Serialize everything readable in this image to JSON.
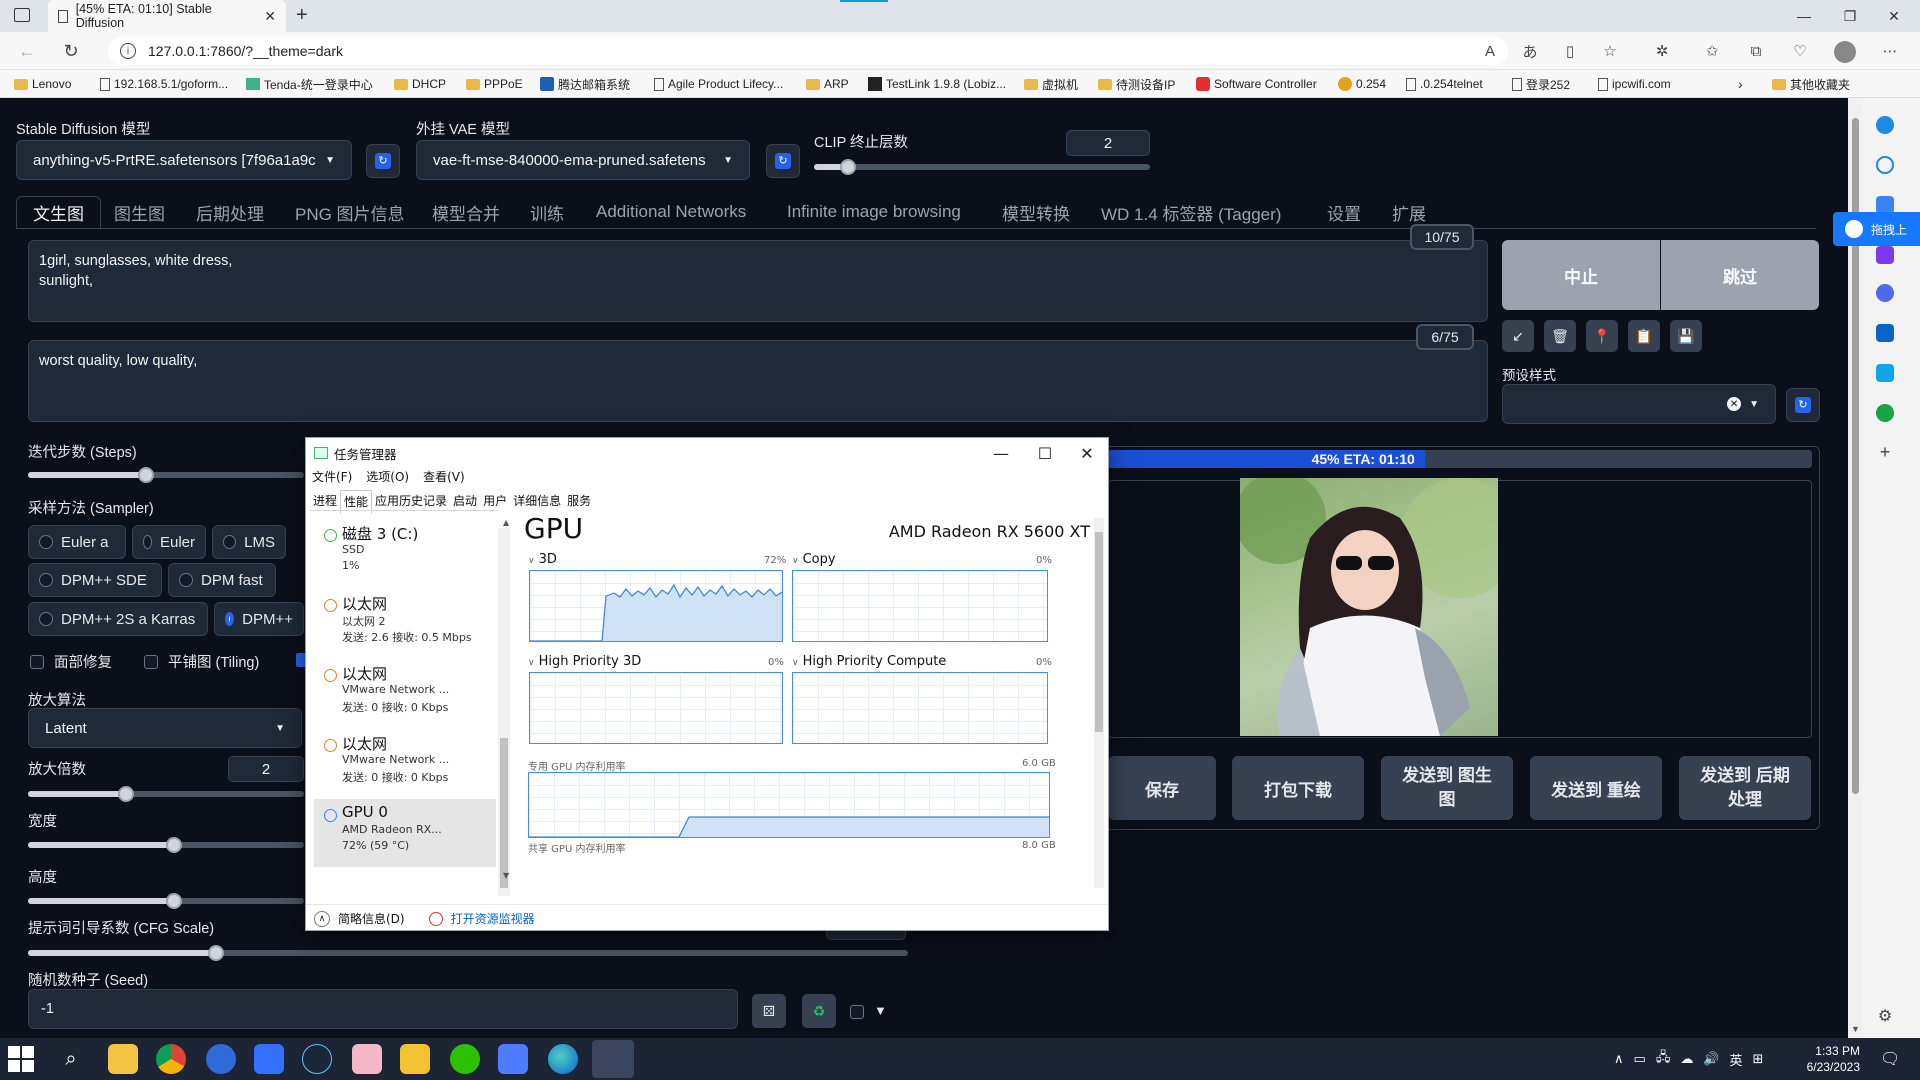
{
  "browser": {
    "tab_title": "[45% ETA: 01:10] Stable Diffusion",
    "url": "127.0.0.1:7860/?__theme=dark",
    "bookmarks": [
      "Lenovo",
      "192.168.5.1/goform...",
      "Tenda-统一登录中心",
      "DHCP",
      "PPPoE",
      "腾达邮箱系统",
      "Agile Product Lifecy...",
      "ARP",
      "TestLink 1.9.8 (Lobiz...",
      "虚拟机",
      "待测设备IP",
      "Software Controller",
      "0.254",
      ".0.254telnet",
      "登录252",
      "ipcwifi.com",
      "其他收藏夹"
    ],
    "side_float_label": "拖拽上"
  },
  "webui": {
    "sd_model_label": "Stable Diffusion 模型",
    "sd_model_value": "anything-v5-PrtRE.safetensors [7f96a1a9c",
    "vae_label": "外挂 VAE 模型",
    "vae_value": "vae-ft-mse-840000-ema-pruned.safetens",
    "clip_label": "CLIP 终止层数",
    "clip_value": "2",
    "clip_level": 0.1,
    "tabs": [
      "文生图",
      "图生图",
      "后期处理",
      "PNG 图片信息",
      "模型合并",
      "训练",
      "Additional Networks",
      "Infinite image browsing",
      "模型转换",
      "WD 1.4 标签器 (Tagger)",
      "设置",
      "扩展"
    ],
    "prompt": "1girl, sunglasses, white dress,\nsunlight,",
    "prompt_counter": "10/75",
    "negative_prompt": "worst quality, low quality,",
    "negative_counter": "6/75",
    "interrupt_label": "中止",
    "skip_label": "跳过",
    "style_label": "预设样式",
    "tool_icons": [
      "↙",
      "🗑",
      "📍",
      "📋",
      "💾"
    ],
    "steps_label": "迭代步数 (Steps)",
    "sampler_label": "采样方法 (Sampler)",
    "samplers": [
      "Euler a",
      "Euler",
      "LMS",
      "DPM++ SDE",
      "DPM fast",
      "DPM++ 2S a Karras",
      "DPM++"
    ],
    "restore_faces": "面部修复",
    "tiling": "平铺图 (Tiling)",
    "upscaler_label": "放大算法",
    "upscaler_value": "Latent",
    "upscale_by_label": "放大倍数",
    "upscale_by_value": "2",
    "width_label": "宽度",
    "height_label": "高度",
    "cfg_label": "提示词引导系数 (CFG Scale)",
    "seed_label": "随机数种子 (Seed)",
    "seed_value": "-1",
    "progress_text": "45% ETA: 01:10",
    "progress": 0.45,
    "actions": [
      "保存",
      "打包下载",
      "发送到 图生图",
      "发送到 重绘",
      "发送到 后期处理"
    ]
  },
  "taskmgr": {
    "title": "任务管理器",
    "menu": [
      "文件(F)",
      "选项(O)",
      "查看(V)"
    ],
    "tabs": [
      "进程",
      "性能",
      "应用历史记录",
      "启动",
      "用户",
      "详细信息",
      "服务"
    ],
    "items": [
      {
        "name": "磁盘 3 (C:)",
        "l1": "SSD",
        "l2": "1%"
      },
      {
        "name": "以太网",
        "l1": "以太网 2",
        "l2": "发送: 2.6 接收: 0.5 Mbps"
      },
      {
        "name": "以太网",
        "l1": "VMware Network ...",
        "l2": "发送: 0 接收: 0 Kbps"
      },
      {
        "name": "以太网",
        "l1": "VMware Network ...",
        "l2": "发送: 0 接收: 0 Kbps"
      },
      {
        "name": "GPU 0",
        "l1": "AMD Radeon RX...",
        "l2": "72% (59 °C)"
      }
    ],
    "gpu_title": "GPU",
    "gpu_model": "AMD Radeon RX 5600 XT",
    "g3d": "3D",
    "g3d_pct": "72%",
    "gcopy": "Copy",
    "gcopy_pct": "0%",
    "ghp3d": "High Priority 3D",
    "ghp3d_pct": "0%",
    "ghpc": "High Priority Compute",
    "ghpc_pct": "0%",
    "dedicated_label": "专用 GPU 内存利用率",
    "dedicated_max": "6.0 GB",
    "shared_label": "共享 GPU 内存利用率",
    "shared_max": "8.0 GB",
    "fewer_details": "简略信息(D)",
    "open_monitor": "打开资源监视器"
  },
  "taskbar": {
    "time": "1:33 PM",
    "date": "6/23/2023",
    "ime": "英"
  }
}
